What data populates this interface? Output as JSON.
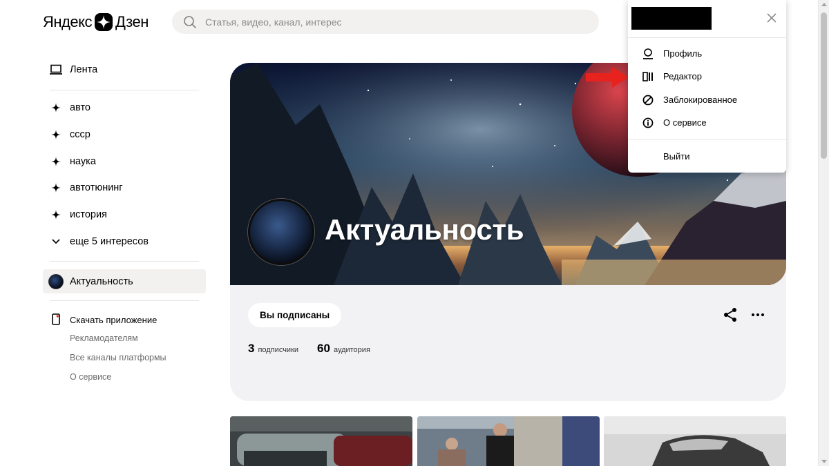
{
  "header": {
    "logo_left": "Яндекс",
    "logo_right": "Дзен",
    "search_placeholder": "Статья, видео, канал, интерес"
  },
  "sidebar": {
    "feed_label": "Лента",
    "interests": [
      {
        "label": "авто",
        "icon": "sparkle-icon"
      },
      {
        "label": "ссср",
        "icon": "sparkle-icon"
      },
      {
        "label": "наука",
        "icon": "sparkle-icon"
      },
      {
        "label": "автотюнинг",
        "icon": "sparkle-icon"
      },
      {
        "label": "история",
        "icon": "sparkle-icon"
      }
    ],
    "more_label": "еще 5 интересов",
    "active_channel": "Актуальность",
    "app_link": "Скачать приложение",
    "footer_links": [
      "Рекламодателям",
      "Все каналы платформы",
      "О сервисе"
    ]
  },
  "channel": {
    "title": "Актуальность",
    "subscribe_label": "Вы подписаны",
    "subscribers_count": "3",
    "subscribers_label": "подписчики",
    "audience_count": "60",
    "audience_label": "аудитория"
  },
  "menu": {
    "items": [
      {
        "label": "Профиль",
        "icon": "profile-icon"
      },
      {
        "label": "Редактор",
        "icon": "editor-icon"
      },
      {
        "label": "Заблокированное",
        "icon": "blocked-icon"
      },
      {
        "label": "О сервисе",
        "icon": "info-icon"
      }
    ],
    "logout_label": "Выйти"
  },
  "colors": {
    "accent_arrow": "#e8231e",
    "panel_bg": "#f2f1f4",
    "search_bg": "#f2f1ef"
  }
}
